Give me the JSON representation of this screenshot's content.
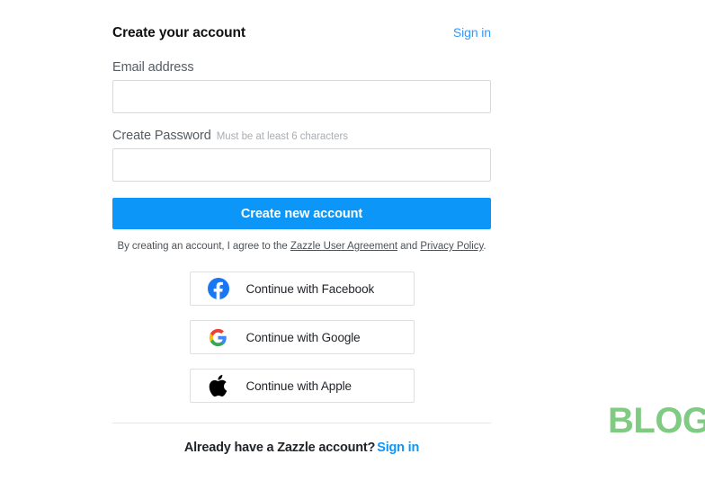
{
  "form": {
    "title": "Create your account",
    "signin_top_label": "Sign in",
    "email": {
      "label": "Email address",
      "value": "",
      "placeholder": ""
    },
    "password": {
      "label": "Create Password",
      "hint": "Must be at least 6 characters",
      "value": "",
      "placeholder": ""
    },
    "submit_label": "Create new account",
    "legal": {
      "prefix": "By creating an account, I agree to the ",
      "agreement_link": "Zazzle User Agreement",
      "middle": " and ",
      "privacy_link": "Privacy Policy",
      "suffix": "."
    },
    "social_buttons": [
      {
        "label": "Continue with Facebook",
        "icon": "facebook-icon",
        "brand_color": "#1977f3"
      },
      {
        "label": "Continue with Google",
        "icon": "google-icon",
        "brand_color": "#4285f4"
      },
      {
        "label": "Continue with Apple",
        "icon": "apple-icon",
        "brand_color": "#000000"
      }
    ],
    "footer": {
      "text": "Already have a Zazzle account?",
      "signin_label": "Sign in"
    }
  },
  "watermark": {
    "text": "BLOG",
    "color": "#7ecb81"
  },
  "colors": {
    "accent_blue": "#0c96f7",
    "link_blue": "#3399ff",
    "border_gray": "#d7d9dc",
    "text_dark": "#1f2328",
    "text_muted": "#a9aeb3"
  }
}
